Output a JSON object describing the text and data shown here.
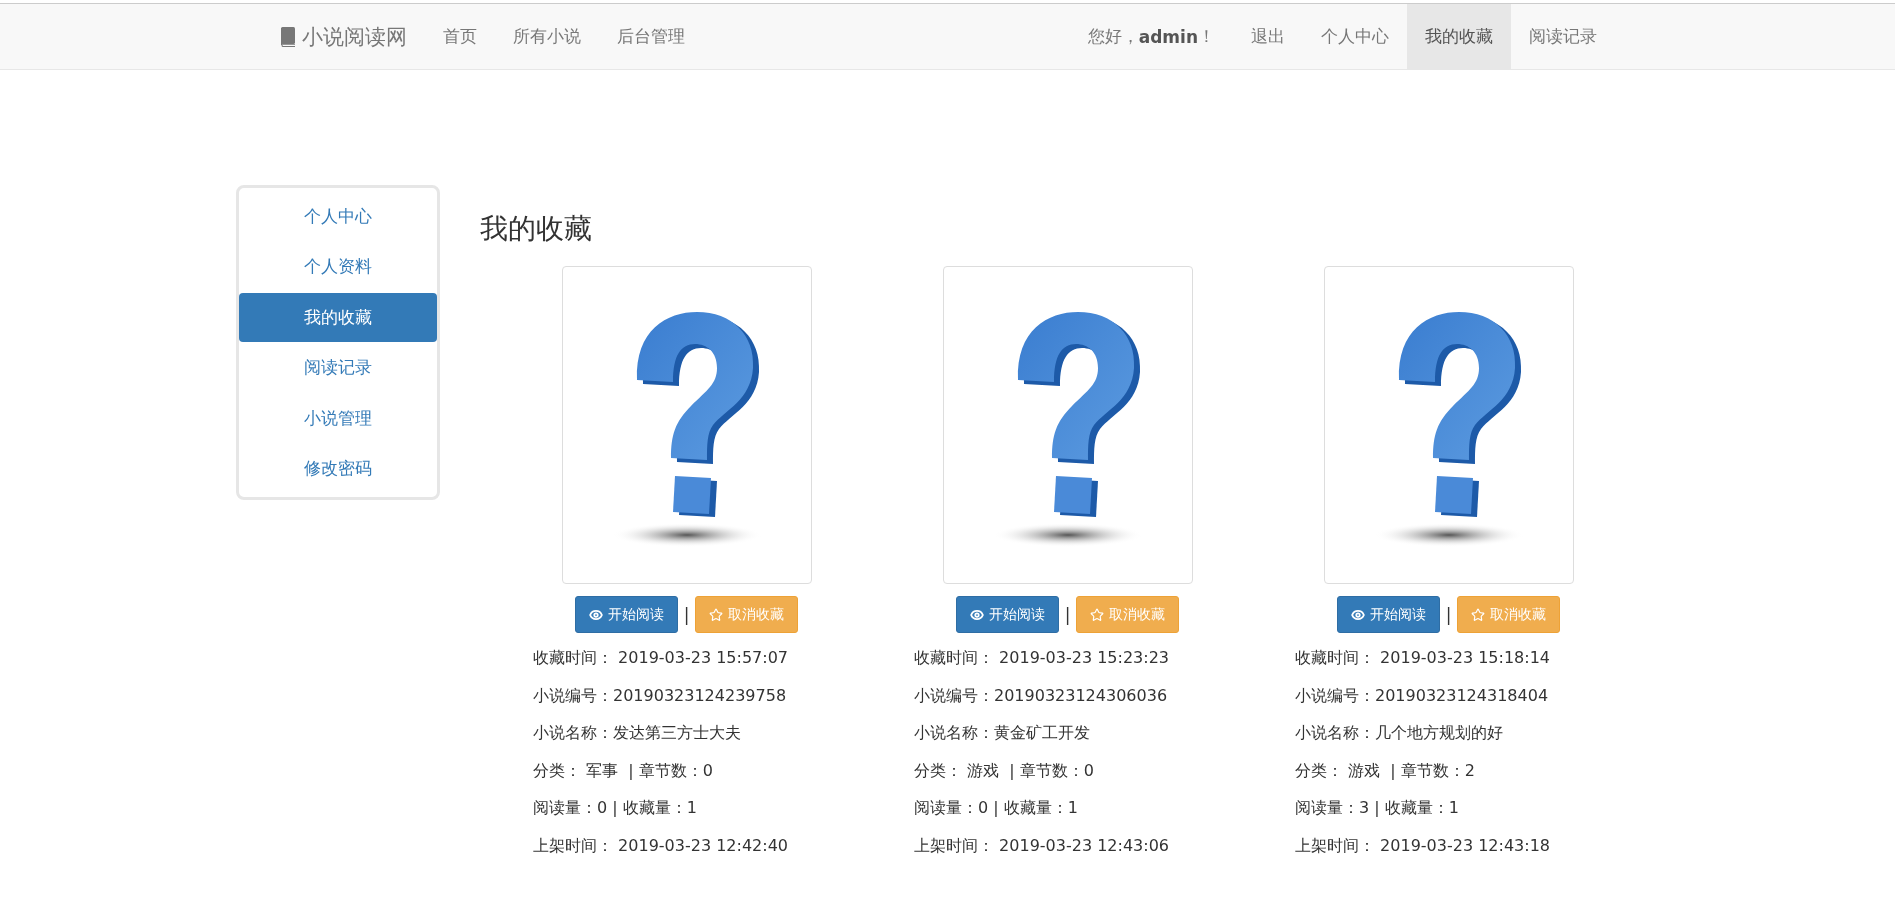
{
  "navbar": {
    "brand": "小说阅读网",
    "links": [
      {
        "label": "首页",
        "selected": false
      },
      {
        "label": "所有小说",
        "selected": false
      },
      {
        "label": "后台管理",
        "selected": false
      }
    ],
    "greeting": "您好，**admin**！",
    "right_links": [
      {
        "label": "退出",
        "selected": false
      },
      {
        "label": "个人中心",
        "selected": false
      },
      {
        "label": "我的收藏",
        "selected": true
      },
      {
        "label": "阅读记录",
        "selected": false
      }
    ]
  },
  "sidebar": {
    "items": [
      {
        "label": "个人中心",
        "selected": false
      },
      {
        "label": "个人资料",
        "selected": false
      },
      {
        "label": "我的收藏",
        "selected": true
      },
      {
        "label": "阅读记录",
        "selected": false
      },
      {
        "label": "小说管理",
        "selected": false
      },
      {
        "label": "修改密码",
        "selected": false
      }
    ]
  },
  "title": "我的收藏",
  "favorites": [
    {
      "read_button": "开始阅读",
      "separator": "|",
      "cancel_button": "取消收藏",
      "details": [
        "收藏时间： 2019-03-23 15:57:07",
        "小说编号：20190323124239758",
        "小说名称：发达第三方士大夫",
        "分类： 军事  | 章节数：0",
        "阅读量：0 | 收藏量：1",
        "上架时间： 2019-03-23 12:42:40"
      ]
    },
    {
      "read_button": "开始阅读",
      "separator": "|",
      "cancel_button": "取消收藏",
      "details": [
        "收藏时间： 2019-03-23 15:23:23",
        "小说编号：20190323124306036",
        "小说名称：黄金矿工开发",
        "分类： 游戏  | 章节数：0",
        "阅读量：0 | 收藏量：1",
        "上架时间： 2019-03-23 12:43:06"
      ]
    },
    {
      "read_button": "开始阅读",
      "separator": "|",
      "cancel_button": "取消收藏",
      "details": [
        "收藏时间： 2019-03-23 15:18:14",
        "小说编号：20190323124318404",
        "小说名称：几个地方规划的好",
        "分类： 游戏  | 章节数：2",
        "阅读量：3 | 收藏量：1",
        "上架时间： 2019-03-23 12:43:18"
      ]
    }
  ]
}
